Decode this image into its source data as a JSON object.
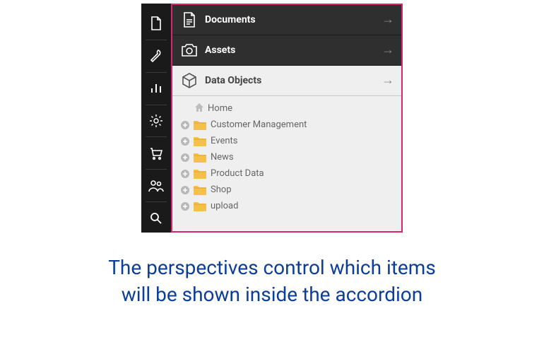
{
  "sidebar": {
    "items": [
      {
        "name": "file-icon"
      },
      {
        "name": "wrench-icon"
      },
      {
        "name": "bar-chart-icon"
      },
      {
        "name": "gear-icon"
      },
      {
        "name": "cart-icon"
      },
      {
        "name": "users-icon"
      },
      {
        "name": "search-icon"
      }
    ]
  },
  "accordion": {
    "items": [
      {
        "label": "Documents",
        "style": "dark",
        "icon": "document-icon"
      },
      {
        "label": "Assets",
        "style": "dark",
        "icon": "camera-icon"
      },
      {
        "label": "Data Objects",
        "style": "light",
        "icon": "cube-icon",
        "expanded": true
      }
    ]
  },
  "tree": {
    "root": {
      "label": "Home"
    },
    "children": [
      {
        "label": "Customer Management"
      },
      {
        "label": "Events"
      },
      {
        "label": "News"
      },
      {
        "label": "Product Data"
      },
      {
        "label": "Shop"
      },
      {
        "label": "upload"
      }
    ]
  },
  "caption": {
    "line1": "The perspectives control which items",
    "line2": "will be shown inside the accordion"
  }
}
